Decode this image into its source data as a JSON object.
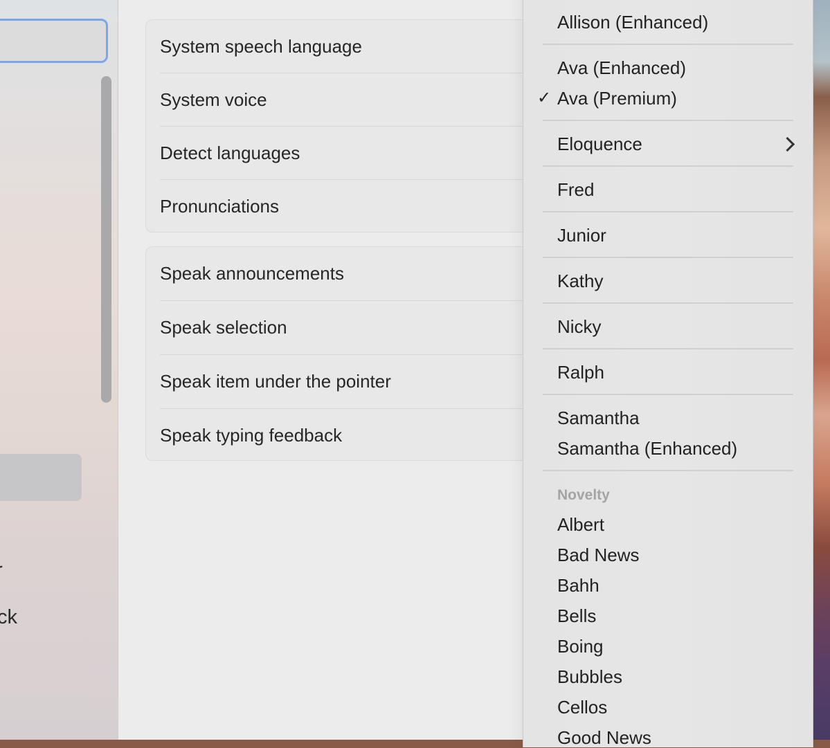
{
  "sidebar": {
    "partial_labels": [
      "r",
      "ck"
    ]
  },
  "main": {
    "group1": [
      "System speech language",
      "System voice",
      "Detect languages",
      "Pronunciations"
    ],
    "group2": [
      "Speak announcements",
      "Speak selection",
      "Speak item under the pointer",
      "Speak typing feedback"
    ]
  },
  "voice_menu": {
    "items": [
      "Allison (Enhanced)",
      "Ava (Enhanced)",
      "Ava (Premium)",
      "Eloquence",
      "Fred",
      "Junior",
      "Kathy",
      "Nicky",
      "Ralph",
      "Samantha",
      "Samantha (Enhanced)"
    ],
    "selected": "Ava (Premium)",
    "check_glyph": "✓",
    "novelty_header": "Novelty",
    "novelty_items": [
      "Albert",
      "Bad News",
      "Bahh",
      "Bells",
      "Boing",
      "Bubbles",
      "Cellos",
      "Good News"
    ]
  },
  "colors": {
    "focus_ring": "#7aa6ec",
    "selection": "#c6c5c8"
  }
}
